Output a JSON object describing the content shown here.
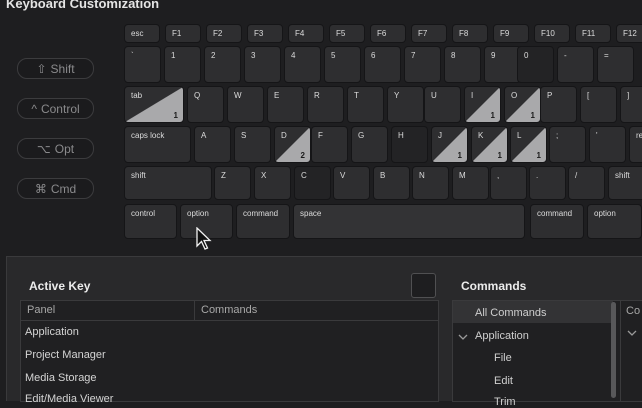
{
  "title": "Keyboard Customization",
  "modifiers": [
    {
      "icon": "⇧",
      "label": "Shift"
    },
    {
      "icon": "^",
      "label": "Control"
    },
    {
      "icon": "⌥",
      "label": "Opt"
    },
    {
      "icon": "⌘",
      "label": "Cmd"
    }
  ],
  "keys": {
    "esc": "esc",
    "f1": "F1",
    "f2": "F2",
    "f3": "F3",
    "f4": "F4",
    "f5": "F5",
    "f6": "F6",
    "f7": "F7",
    "f8": "F8",
    "f9": "F9",
    "f10": "F10",
    "f11": "F11",
    "f12": "F12",
    "backtick": "`",
    "n1": "1",
    "n2": "2",
    "n3": "3",
    "n4": "4",
    "n5": "5",
    "n6": "6",
    "n7": "7",
    "n8": "8",
    "n9": "9",
    "n0": "0",
    "minus": "-",
    "equals": "=",
    "tab": "tab",
    "q": "Q",
    "w": "W",
    "e": "E",
    "r": "R",
    "t": "T",
    "y": "Y",
    "u": "U",
    "i": "I",
    "o": "O",
    "p": "P",
    "lbracket": "[",
    "rbracket": "]",
    "capslock": "caps lock",
    "a": "A",
    "s": "S",
    "d": "D",
    "f": "F",
    "g": "G",
    "h": "H",
    "j": "J",
    "k": "K",
    "l": "L",
    "semicolon": ";",
    "quote": "'",
    "return": "re",
    "shift_left": "shift",
    "z": "Z",
    "x": "X",
    "c": "C",
    "v": "V",
    "b": "B",
    "n": "N",
    "m": "M",
    "comma": ",",
    "period": ".",
    "slash": "/",
    "shift_right": "shift",
    "control": "control",
    "option_left": "option",
    "command_left": "command",
    "space": "space",
    "command_right": "command",
    "option_right": "option"
  },
  "counts": {
    "tab": "1",
    "i": "1",
    "o": "1",
    "d": "2",
    "j": "1",
    "k": "1",
    "l": "1"
  },
  "active_key": {
    "heading": "Active Key",
    "col_panel": "Panel",
    "col_commands": "Commands",
    "rows": [
      "Application",
      "Project Manager",
      "Media Storage",
      "Edit/Media Viewer"
    ]
  },
  "commands": {
    "heading": "Commands",
    "items": [
      "All Commands",
      "Application",
      "File",
      "Edit",
      "Trim"
    ],
    "side_header": "Co"
  }
}
